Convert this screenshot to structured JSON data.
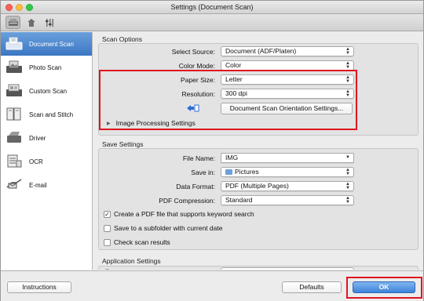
{
  "window": {
    "title": "Settings (Document Scan)"
  },
  "toolbar": {
    "tabs": [
      {
        "icon": "scan-settings-icon"
      },
      {
        "icon": "general-settings-icon"
      },
      {
        "icon": "preferences-icon"
      }
    ]
  },
  "sidebar": {
    "items": [
      {
        "label": "Document Scan",
        "icon": "document-scan-icon",
        "selected": true
      },
      {
        "label": "Photo Scan",
        "icon": "photo-scan-icon"
      },
      {
        "label": "Custom Scan",
        "icon": "custom-scan-icon"
      },
      {
        "label": "Scan and Stitch",
        "icon": "scan-and-stitch-icon"
      },
      {
        "label": "Driver",
        "icon": "driver-icon"
      },
      {
        "label": "OCR",
        "icon": "ocr-icon"
      },
      {
        "label": "E-mail",
        "icon": "email-icon"
      }
    ]
  },
  "scan_options": {
    "heading": "Scan Options",
    "select_source_label": "Select Source:",
    "select_source_value": "Document (ADF/Platen)",
    "color_mode_label": "Color Mode:",
    "color_mode_value": "Color",
    "paper_size_label": "Paper Size:",
    "paper_size_value": "Letter",
    "resolution_label": "Resolution:",
    "resolution_value": "300 dpi",
    "orientation_button": "Document Scan Orientation Settings...",
    "image_processing_label": "Image Processing Settings"
  },
  "save_settings": {
    "heading": "Save Settings",
    "file_name_label": "File Name:",
    "file_name_value": "IMG",
    "save_in_label": "Save in:",
    "save_in_value": "Pictures",
    "data_format_label": "Data Format:",
    "data_format_value": "PDF (Multiple Pages)",
    "pdf_compression_label": "PDF Compression:",
    "pdf_compression_value": "Standard",
    "keyword_search_label": "Create a PDF file that supports keyword search",
    "keyword_search_checked": true,
    "subfolder_label": "Save to a subfolder with current date",
    "subfolder_checked": false,
    "check_results_label": "Check scan results",
    "check_results_checked": false
  },
  "application_settings": {
    "heading": "Application Settings"
  },
  "footer": {
    "instructions_button": "Instructions",
    "defaults_button": "Defaults",
    "ok_button": "OK"
  },
  "colors": {
    "highlight": "#e0141e",
    "selected_item": "#3b76c3",
    "default_button": "#3e83dc"
  }
}
